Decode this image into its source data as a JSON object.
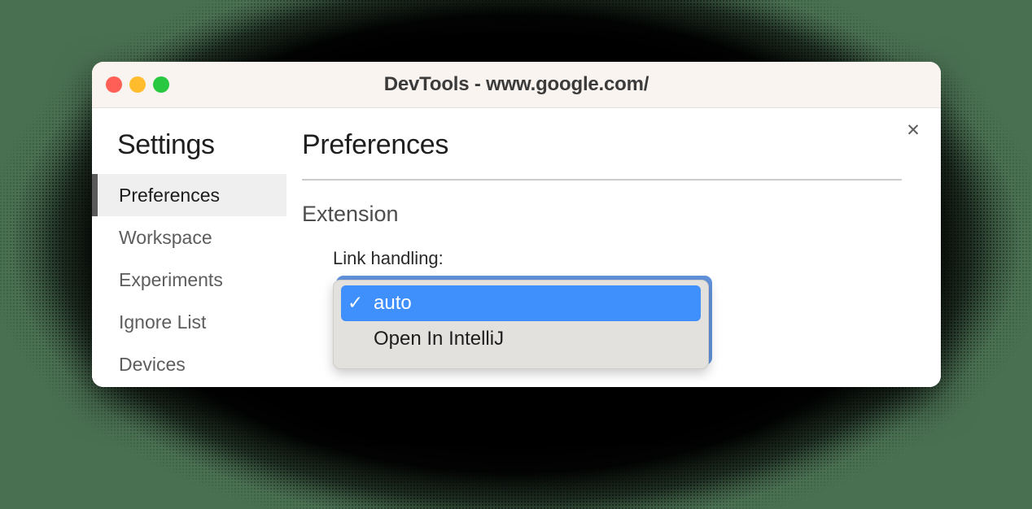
{
  "window": {
    "title": "DevTools - www.google.com/",
    "traffic_lights": [
      {
        "name": "close",
        "color": "#ff5f57"
      },
      {
        "name": "minimize",
        "color": "#ffbd2e"
      },
      {
        "name": "zoom",
        "color": "#28c840"
      }
    ],
    "close_glyph": "✕"
  },
  "sidebar": {
    "heading": "Settings",
    "items": [
      {
        "label": "Preferences",
        "selected": true
      },
      {
        "label": "Workspace",
        "selected": false
      },
      {
        "label": "Experiments",
        "selected": false
      },
      {
        "label": "Ignore List",
        "selected": false
      },
      {
        "label": "Devices",
        "selected": false
      }
    ]
  },
  "main": {
    "title": "Preferences",
    "section": "Extension",
    "field": {
      "label": "Link handling:",
      "selected_value": "auto",
      "options": [
        {
          "label": "auto",
          "selected": true,
          "check": "✓"
        },
        {
          "label": "Open In IntelliJ",
          "selected": false,
          "check": ""
        }
      ]
    }
  },
  "colors": {
    "backdrop_green": "#4a7052",
    "titlebar": "#faf4f0",
    "accent_blue": "#3f8ffc",
    "selected_row": "#efefef",
    "selection_bar": "#5a5a5a"
  }
}
